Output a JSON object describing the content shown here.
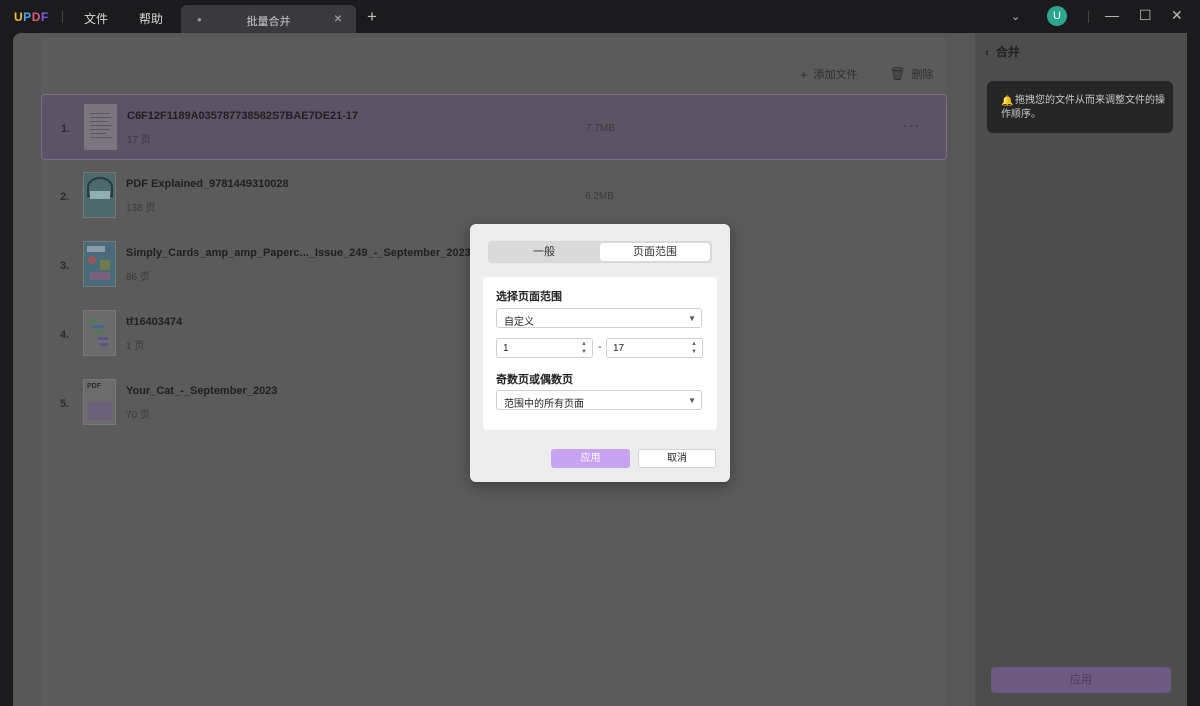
{
  "app": {
    "logo": "UPDF",
    "menu": [
      "文件",
      "帮助"
    ],
    "tab_title": "批量合并",
    "avatar_initial": "U"
  },
  "toolbar": {
    "add_file_label": "添加文件",
    "delete_label": "删除"
  },
  "files": [
    {
      "index": "1.",
      "name": "C6F12F1189A035787738582S7BAE7DE21-17",
      "pages": "17 页",
      "size": "7.7MB",
      "selected": true
    },
    {
      "index": "2.",
      "name": "PDF Explained_9781449310028",
      "pages": "138 页",
      "size": "6.2MB"
    },
    {
      "index": "3.",
      "name": "Simply_Cards_amp_amp_Paperc..._Issue_249_-_September_2023",
      "pages": "86 页"
    },
    {
      "index": "4.",
      "name": "tf16403474",
      "pages": "1 页"
    },
    {
      "index": "5.",
      "name": "Your_Cat_-_September_2023",
      "pages": "70 页"
    }
  ],
  "right_panel": {
    "title": "合并",
    "tip": "拖拽您的文件从而来调整文件的操作顺序。",
    "apply_label": "应用"
  },
  "dialog": {
    "tabs": [
      "一般",
      "页面范围"
    ],
    "active_tab": "页面范围",
    "range_label": "选择页面范围",
    "range_value": "自定义",
    "from_page": "1",
    "to_page": "17",
    "odd_even_label": "奇数页或偶数页",
    "odd_even_value": "范围中的所有页面",
    "apply_label": "应用",
    "cancel_label": "取消"
  },
  "colors": {
    "accent": "#c7a3f2",
    "selected_row": "#5e5366"
  }
}
